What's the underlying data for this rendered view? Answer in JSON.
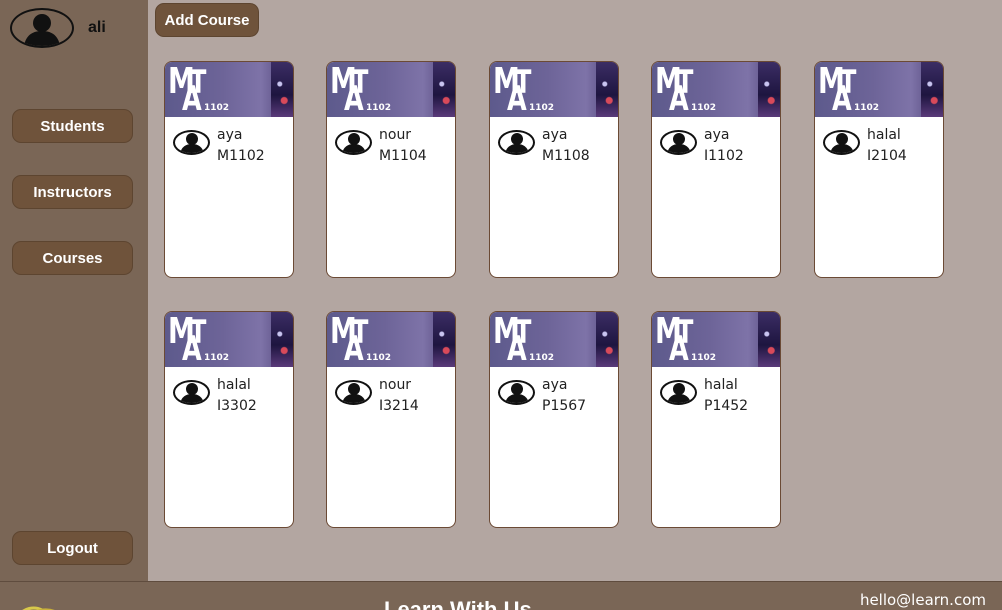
{
  "user": {
    "name": "ali",
    "avatar_icon": "user-silhouette-icon"
  },
  "nav": {
    "students": "Students",
    "instructors": "Instructors",
    "courses": "Courses",
    "logout": "Logout"
  },
  "toolbar": {
    "add_course": "Add Course"
  },
  "course_banner": {
    "letters": [
      "M",
      "T",
      "A"
    ],
    "number": "1102"
  },
  "courses": [
    {
      "instructor": "aya",
      "code": "M1102"
    },
    {
      "instructor": "nour",
      "code": "M1104"
    },
    {
      "instructor": "aya",
      "code": "M1108"
    },
    {
      "instructor": "aya",
      "code": "I1102"
    },
    {
      "instructor": "halal",
      "code": "I2104"
    },
    {
      "instructor": "halal",
      "code": "I3302"
    },
    {
      "instructor": "nour",
      "code": "I3214"
    },
    {
      "instructor": "aya",
      "code": "P1567"
    },
    {
      "instructor": "halal",
      "code": "P1452"
    }
  ],
  "footer": {
    "title": "Learn With Us",
    "email": "hello@learn.com"
  },
  "colors": {
    "sidebar": "#7a6656",
    "button": "#6f533b",
    "background": "#b3a6a1",
    "banner": "#6d6498"
  }
}
